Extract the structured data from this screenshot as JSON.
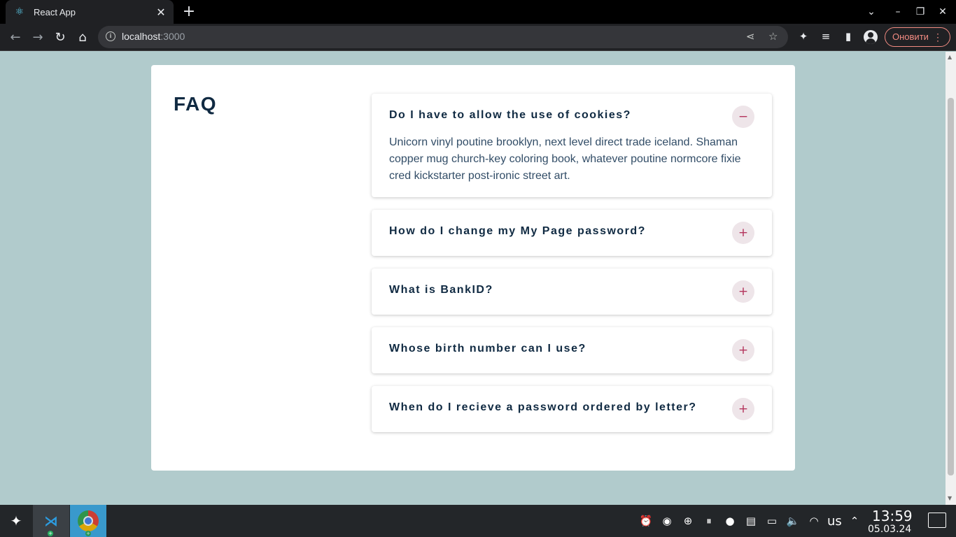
{
  "browser": {
    "tab": {
      "title": "React App",
      "icon": "react-icon"
    },
    "url_host": "localhost",
    "url_port": ":3000",
    "update_button_label": "Оновити"
  },
  "page": {
    "title": "FAQ",
    "questions": [
      {
        "question": "Do I have to allow the use of cookies?",
        "expanded": true,
        "toggle": "−",
        "answer": "Unicorn vinyl poutine brooklyn, next level direct trade iceland. Shaman copper mug church-key coloring book, whatever poutine normcore fixie cred kickstarter post-ironic street art."
      },
      {
        "question": "How do I change my My Page password?",
        "expanded": false,
        "toggle": "+"
      },
      {
        "question": "What is BankID?",
        "expanded": false,
        "toggle": "+"
      },
      {
        "question": "Whose birth number can I use?",
        "expanded": false,
        "toggle": "+"
      },
      {
        "question": "When do I recieve a password ordered by letter?",
        "expanded": false,
        "toggle": "+"
      }
    ],
    "colors": {
      "background": "#b1cbcc",
      "heading": "#102a42",
      "toggle_icon": "#b4345c",
      "toggle_bg": "#eee5e9"
    }
  },
  "taskbar": {
    "keyboard_layout": "us",
    "time": "13:59",
    "date": "05.03.24"
  }
}
